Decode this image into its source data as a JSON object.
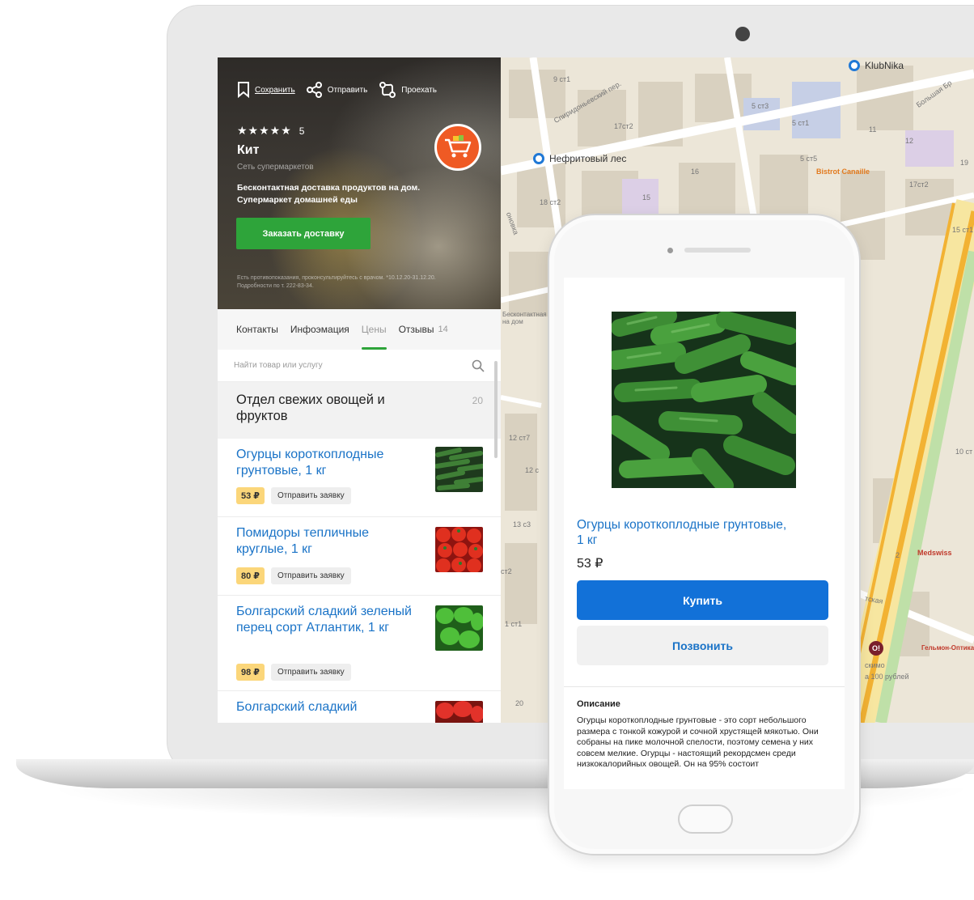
{
  "hero": {
    "actions": [
      {
        "label": "Сохранить",
        "icon": "bookmark-icon"
      },
      {
        "label": "Отправить",
        "icon": "share-icon"
      },
      {
        "label": "Проехать",
        "icon": "route-icon"
      }
    ],
    "stars": "★★★★★",
    "rating": "5",
    "name": "Кит",
    "type": "Сеть супермаркетов",
    "description": "Бесконтактная доставка продуктов на дом. Супермаркет домашней еды",
    "order_button": "Заказать доставку",
    "fine_print": "Есть противопоказания, проконсультируйтесь с врачом. *10.12.20-31.12.20. Подробности по т. 222-83-34.",
    "cart_color": "#ef5a24"
  },
  "tabs": [
    {
      "label": "Контакты",
      "count": ""
    },
    {
      "label": "Инфоэмация",
      "count": ""
    },
    {
      "label": "Цены",
      "count": ""
    },
    {
      "label": "Отзывы",
      "count": "14"
    }
  ],
  "search": {
    "placeholder": "Найти товар или услугу"
  },
  "category": {
    "title": "Отдел свежих овощей и фруктов",
    "count": "20"
  },
  "products": [
    {
      "title": "Огурцы короткоплодные грунтовые, 1 кг",
      "price": "53 ₽",
      "action": "Отправить заявку",
      "thumb": "cucumbers"
    },
    {
      "title": "Помидоры тепличные круглые, 1 кг",
      "price": "80 ₽",
      "action": "Отправить заявку",
      "thumb": "tomatoes"
    },
    {
      "title": "Болгарский сладкий зеленый перец сорт Атлантик, 1 кг",
      "price": "98 ₽",
      "action": "Отправить заявку",
      "thumb": "green-peppers"
    },
    {
      "title": "Болгарский сладкий",
      "price": "",
      "action": "",
      "thumb": "red-peppers"
    }
  ],
  "map": {
    "pois": [
      {
        "label": "KlubNika"
      },
      {
        "label": "Нефритовый лес"
      }
    ],
    "labels": [
      "Спиридоньевский пер.",
      "Bistrot Canaille",
      "Medswiss",
      "Бесконтактная на дом",
      "Гельмон-Оптика",
      "скимо",
      "а 100 рублей",
      "Большая Бр",
      "тская",
      "оновка",
      "9 ст1",
      "17ст2",
      "5 ст3",
      "5 ст1",
      "11",
      "16",
      "15",
      "18 ст2",
      "5 ст5",
      "12",
      "19",
      "17ст2",
      "15 ст1",
      "12 ст7",
      "12 с",
      "13 с3",
      "ст2",
      "1 ст1",
      "20",
      "2",
      "10 ст"
    ],
    "road_color": "#f2b233"
  },
  "phone": {
    "title": "Огурцы короткоплодные грунтовые, 1 кг",
    "price": "53 ₽",
    "buy": "Купить",
    "call": "Позвонить",
    "desc_title": "Описание",
    "desc_text": "Огурцы короткоплодные грунтовые - это сорт небольшого размера с тонкой кожурой и сочной хрустящей мякотью. Они собраны на пике молочной спелости, поэтому семена у них совсем мелкие. Огурцы - настоящий рекордсмен среди низкокалорийных овощей. Он на 95% состоит",
    "buy_color": "#1271d8"
  }
}
